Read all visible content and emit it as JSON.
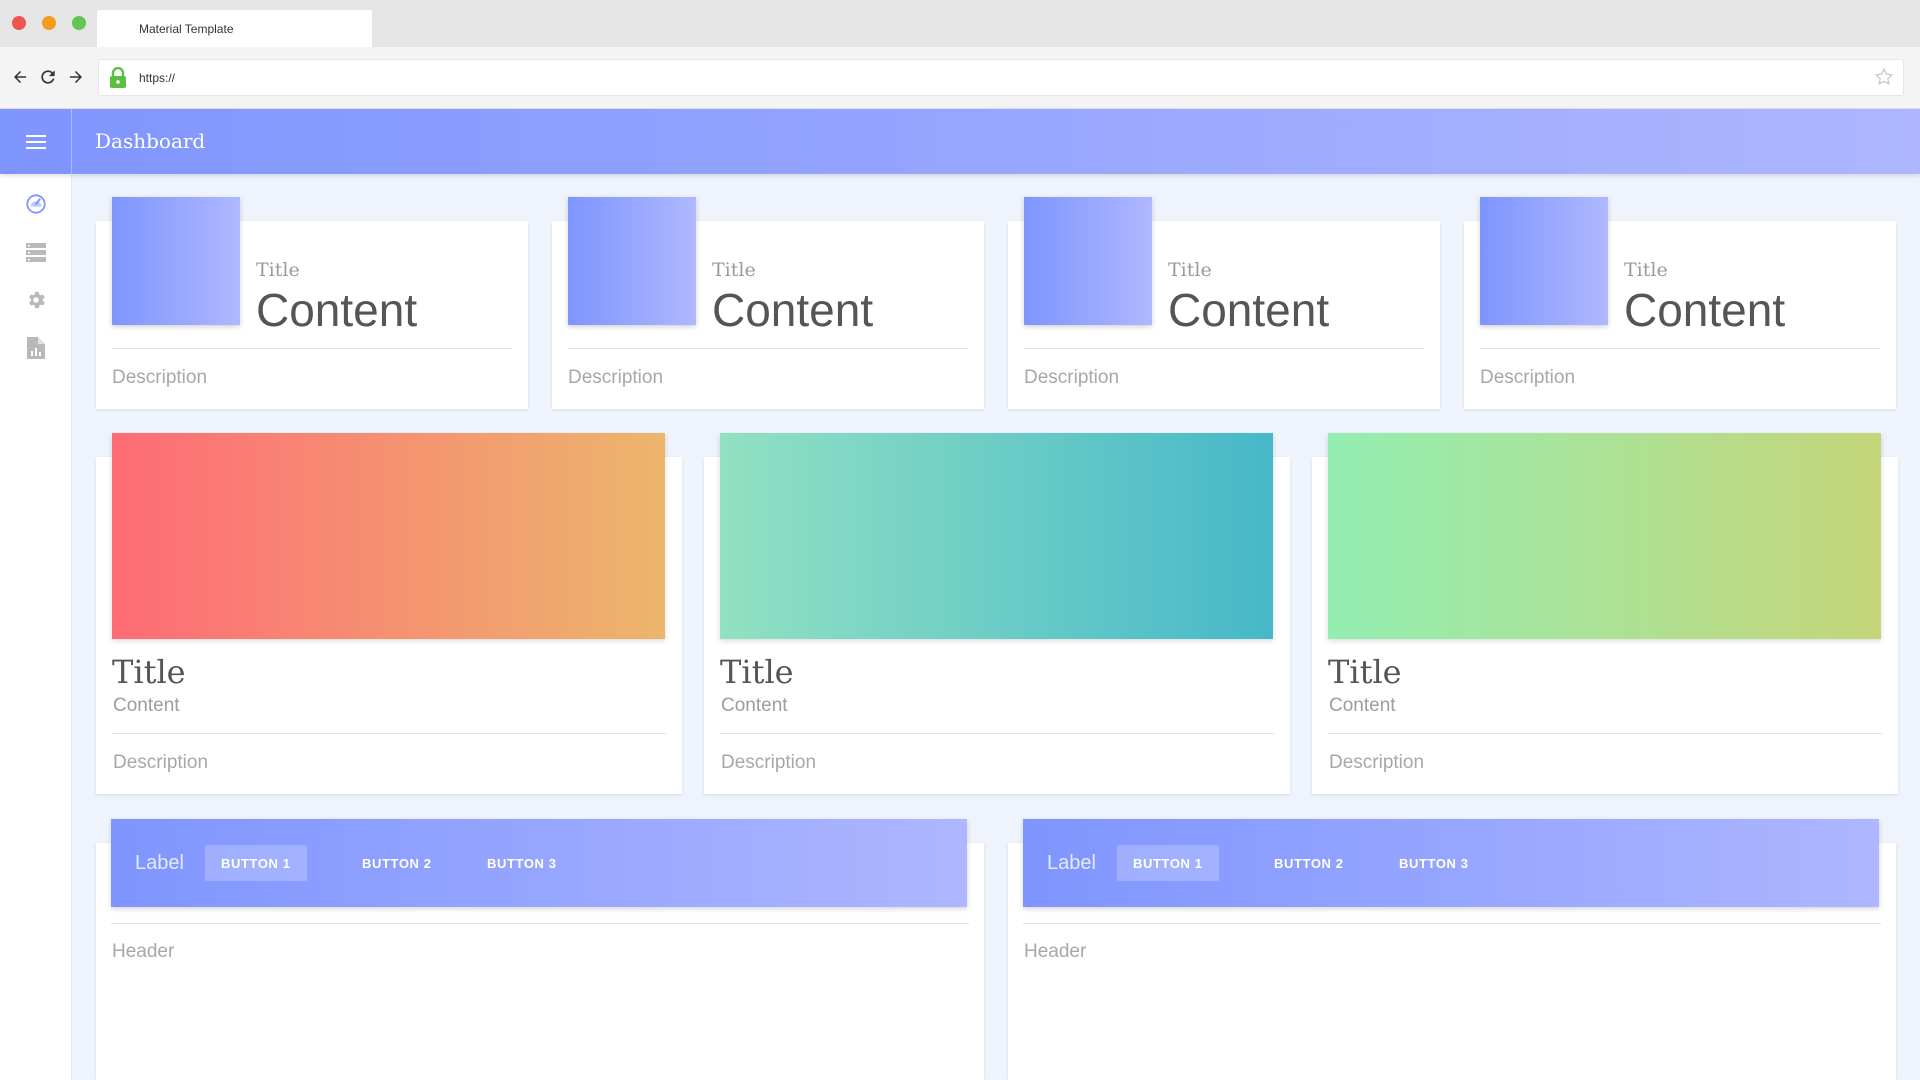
{
  "browser": {
    "tab_title": "Material Template",
    "url": "https://"
  },
  "app": {
    "title": "Dashboard",
    "sidebar": [
      {
        "icon": "dashboard-icon"
      },
      {
        "icon": "storage-icon"
      },
      {
        "icon": "settings-icon"
      },
      {
        "icon": "report-icon"
      }
    ]
  },
  "stat_cards": [
    {
      "title": "Title",
      "content": "Content",
      "description": "Description"
    },
    {
      "title": "Title",
      "content": "Content",
      "description": "Description"
    },
    {
      "title": "Title",
      "content": "Content",
      "description": "Description"
    },
    {
      "title": "Title",
      "content": "Content",
      "description": "Description"
    }
  ],
  "image_cards": [
    {
      "title": "Title",
      "content": "Content",
      "description": "Description",
      "gradient": [
        "#fe6b76",
        "#ecb66c"
      ]
    },
    {
      "title": "Title",
      "content": "Content",
      "description": "Description",
      "gradient": [
        "#92e1c2",
        "#46b8c9"
      ]
    },
    {
      "title": "Title",
      "content": "Content",
      "description": "Description",
      "gradient": [
        "#93eeb2",
        "#c5d579"
      ]
    }
  ],
  "tab_cards": [
    {
      "label": "Label",
      "buttons": [
        "BUTTON 1",
        "BUTTON 2",
        "BUTTON 3"
      ],
      "header": "Header"
    },
    {
      "label": "Label",
      "buttons": [
        "BUTTON 1",
        "BUTTON 2",
        "BUTTON 3"
      ],
      "header": "Header"
    }
  ],
  "colors": {
    "primary_start": "#7f95fe",
    "primary_end": "#adb6ff",
    "background": "#eff3fb"
  }
}
